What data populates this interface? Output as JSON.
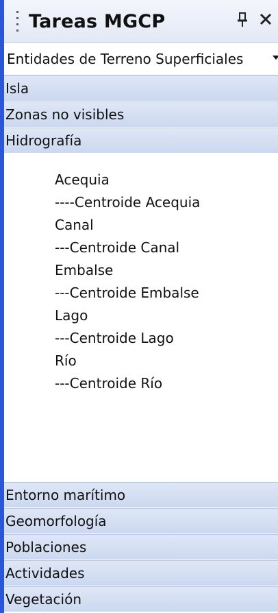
{
  "panel": {
    "title": "Tareas MGCP",
    "pin_glyph": "p",
    "close_glyph": "×",
    "icons": [
      "grip-icon",
      "pin-icon",
      "close-icon"
    ]
  },
  "selector": {
    "selected": "Entidades de Terreno Superficiales"
  },
  "groups_top": [
    {
      "label": "Isla"
    },
    {
      "label": "Zonas no visibles"
    },
    {
      "label": "Hidrografía"
    }
  ],
  "expanded_group": {
    "items": [
      "Acequia",
      "----Centroide Acequia",
      "Canal",
      "---Centroide Canal",
      "Embalse",
      "---Centroide Embalse",
      "Lago",
      "---Centroide Lago",
      "Río",
      "---Centroide Río"
    ]
  },
  "groups_bottom": [
    {
      "label": "Entorno marítimo"
    },
    {
      "label": "Geomorfología"
    },
    {
      "label": "Poblaciones"
    },
    {
      "label": "Actividades"
    },
    {
      "label": "Vegetación"
    }
  ]
}
